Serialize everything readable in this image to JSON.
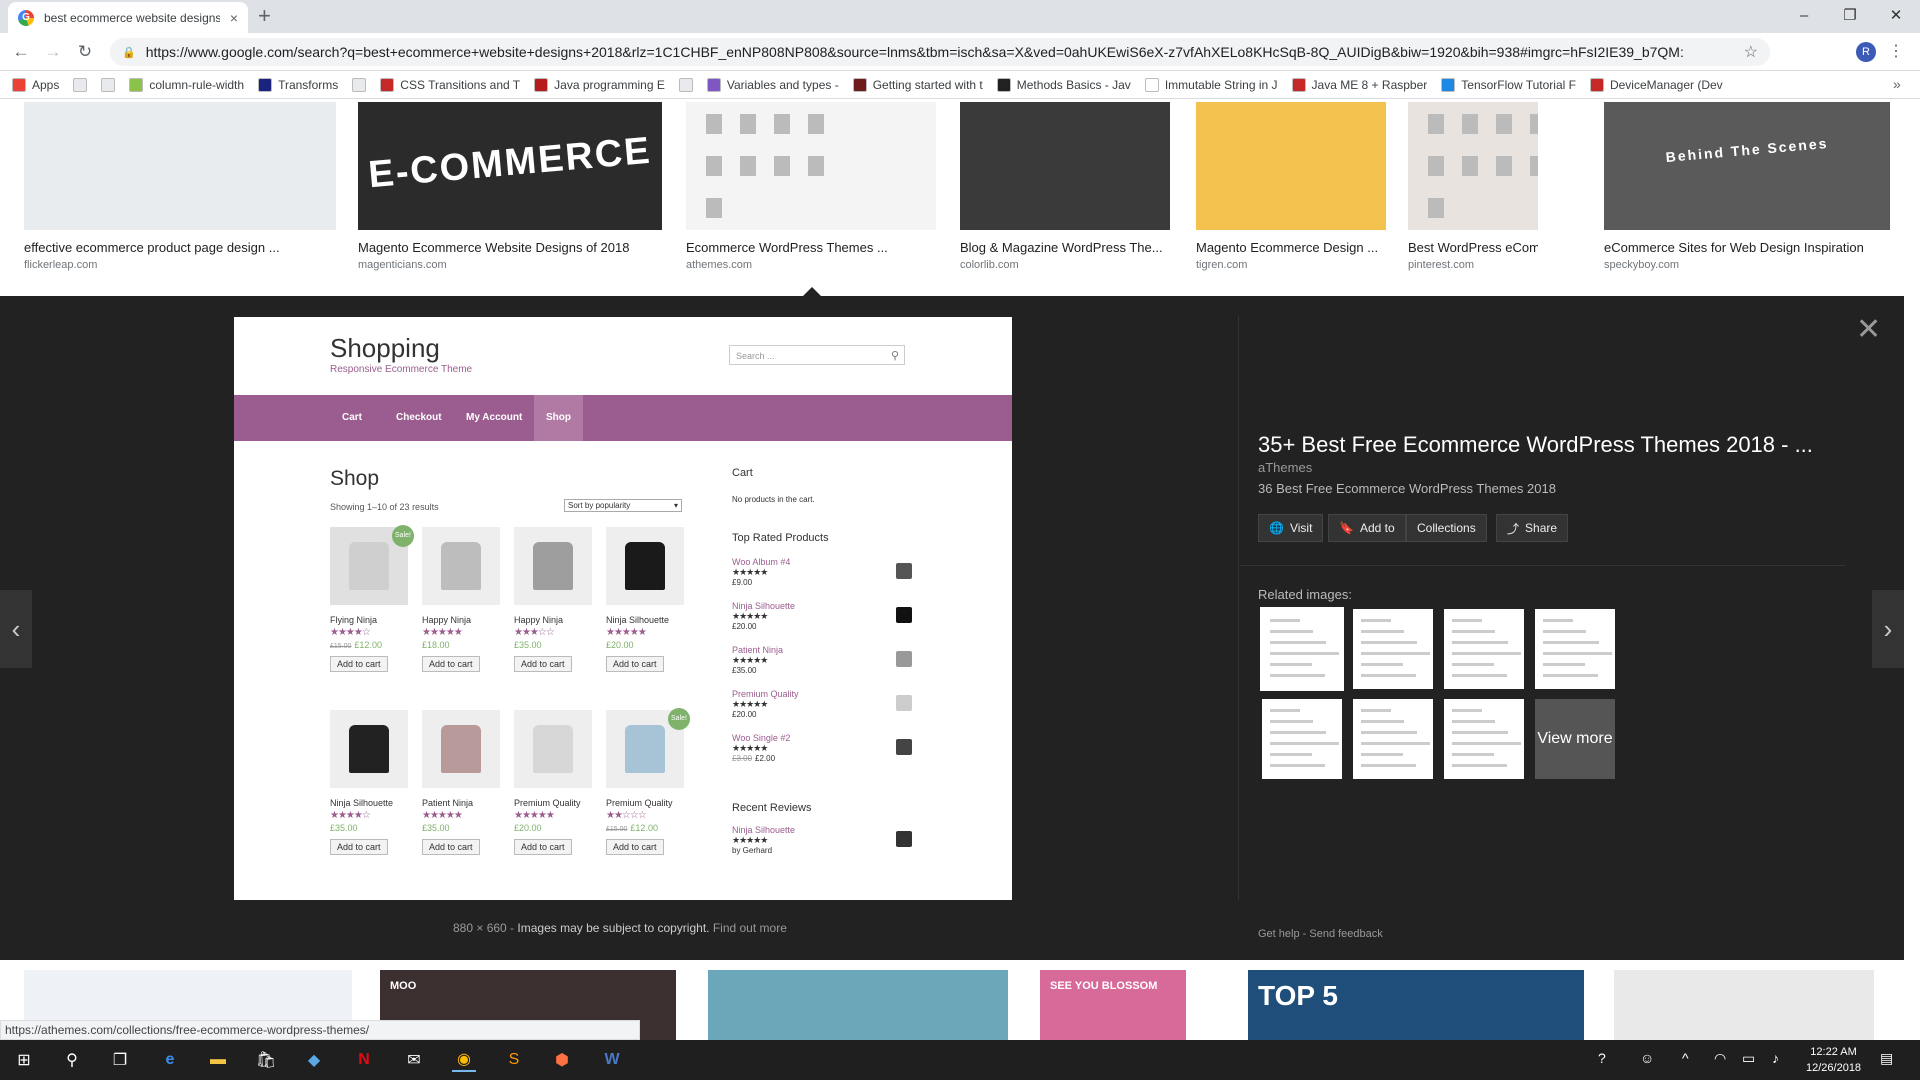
{
  "browser": {
    "tab_title": "best ecommerce website designs",
    "tab_close": "×",
    "new_tab": "+",
    "url": "https://www.google.com/search?q=best+ecommerce+website+designs+2018&rlz=1C1CHBF_enNP808NP808&source=lnms&tbm=isch&sa=X&ved=0ahUKEwiS6eX-z7vfAhXELo8KHcSqB-8Q_AUIDigB&biw=1920&bih=938#imgrc=hFsI2IE39_b7QM:",
    "profile_initial": "R",
    "window_controls": {
      "minimize": "–",
      "maximize": "❐",
      "close": "✕"
    }
  },
  "bookmarks": [
    {
      "label": "Apps",
      "color": "#ea4335"
    },
    {
      "label": "",
      "color": "#e8eaed"
    },
    {
      "label": "",
      "color": "#e8eaed"
    },
    {
      "label": "column-rule-width",
      "color": "#8bc34a"
    },
    {
      "label": "Transforms",
      "color": "#1a237e"
    },
    {
      "label": "",
      "color": "#e8eaed"
    },
    {
      "label": "CSS Transitions and T",
      "color": "#c62828"
    },
    {
      "label": "Java programming E",
      "color": "#b71c1c"
    },
    {
      "label": "",
      "color": "#e8eaed"
    },
    {
      "label": "Variables and types -",
      "color": "#7e57c2"
    },
    {
      "label": "Getting started with t",
      "color": "#6d1b1b"
    },
    {
      "label": "Methods Basics - Jav",
      "color": "#212121"
    },
    {
      "label": "Immutable String in J",
      "color": "#ffffff"
    },
    {
      "label": "Java ME 8 + Raspber",
      "color": "#c62828"
    },
    {
      "label": "TensorFlow Tutorial F",
      "color": "#1e88e5"
    },
    {
      "label": "DeviceManager (Dev",
      "color": "#c62828"
    }
  ],
  "top_results": [
    {
      "caption": "effective ecommerce product page design ...",
      "domain": "flickerleap.com",
      "bg": "#e9ecef"
    },
    {
      "caption": "Magento Ecommerce Website Designs of 2018",
      "domain": "magenticians.com",
      "bg": "#2b2b2b",
      "overlay": "E-COMMERCE"
    },
    {
      "caption": "Ecommerce WordPress Themes ...",
      "domain": "athemes.com",
      "bg": "#f4f4f4"
    },
    {
      "caption": "Blog & Magazine WordPress The...",
      "domain": "colorlib.com",
      "bg": "#3a3a3a"
    },
    {
      "caption": "Magento Ecommerce Design ...",
      "domain": "tigren.com",
      "bg": "#f2c14e"
    },
    {
      "caption": "Best WordPress eCommer...",
      "domain": "pinterest.com",
      "bg": "#e8e3de"
    },
    {
      "caption": "eCommerce Sites for Web Design Inspiration",
      "domain": "speckyboy.com",
      "bg": "#5a5a5a",
      "overlay": "Behind The Scenes"
    }
  ],
  "preview": {
    "site_title": "Shopping",
    "tagline": "Responsive Ecommerce Theme",
    "search_placeholder": "Search ...",
    "nav": [
      "Cart",
      "Checkout",
      "My Account",
      "Shop"
    ],
    "heading": "Shop",
    "result_count": "Showing 1–10 of 23 results",
    "sort": "Sort by popularity",
    "products": [
      {
        "name": "Flying Ninja",
        "stars": "★★★★☆",
        "old_price": "£15.00",
        "price": "£12.00",
        "sale": true,
        "color": "#e0e0e0",
        "tee": "#cfcfcf"
      },
      {
        "name": "Happy Ninja",
        "stars": "★★★★★",
        "old_price": "",
        "price": "£18.00",
        "sale": false,
        "color": "#eeeeee",
        "tee": "#bdbdbd"
      },
      {
        "name": "Happy Ninja",
        "stars": "★★★☆☆",
        "old_price": "",
        "price": "£35.00",
        "sale": false,
        "color": "#eeeeee",
        "tee": "#9e9e9e"
      },
      {
        "name": "Ninja Silhouette",
        "stars": "★★★★★",
        "old_price": "",
        "price": "£20.00",
        "sale": false,
        "color": "#eeeeee",
        "tee": "#1a1a1a"
      },
      {
        "name": "Ninja Silhouette",
        "stars": "★★★★☆",
        "old_price": "",
        "price": "£35.00",
        "sale": false,
        "color": "#eeeeee",
        "tee": "#222222"
      },
      {
        "name": "Patient Ninja",
        "stars": "★★★★★",
        "old_price": "",
        "price": "£35.00",
        "sale": false,
        "color": "#eeeeee",
        "tee": "#b89a9a"
      },
      {
        "name": "Premium Quality",
        "stars": "★★★★★",
        "old_price": "",
        "price": "£20.00",
        "sale": false,
        "color": "#eeeeee",
        "tee": "#d7d7d7"
      },
      {
        "name": "Premium Quality",
        "stars": "★★☆☆☆",
        "old_price": "£15.00",
        "price": "£12.00",
        "sale": true,
        "color": "#eeeeee",
        "tee": "#a7c4d6"
      }
    ],
    "add_to_cart": "Add to cart",
    "sale_badge": "Sale!",
    "cart_heading": "Cart",
    "cart_empty": "No products in the cart.",
    "top_rated_heading": "Top Rated Products",
    "top_rated": [
      {
        "name": "Woo Album #4",
        "stars": "★★★★★",
        "old_price": "",
        "price": "£9.00"
      },
      {
        "name": "Ninja Silhouette",
        "stars": "★★★★★",
        "old_price": "",
        "price": "£20.00"
      },
      {
        "name": "Patient Ninja",
        "stars": "★★★★★",
        "old_price": "",
        "price": "£35.00"
      },
      {
        "name": "Premium Quality",
        "stars": "★★★★★",
        "old_price": "",
        "price": "£20.00"
      },
      {
        "name": "Woo Single #2",
        "stars": "★★★★★",
        "old_price": "£3.00",
        "price": "£2.00"
      }
    ],
    "recent_reviews_heading": "Recent Reviews",
    "review": {
      "name": "Ninja Silhouette",
      "stars": "★★★★★",
      "by": "by Gerhard"
    }
  },
  "info": {
    "title": "35+ Best Free Ecommerce WordPress Themes 2018 - ...",
    "site": "aThemes",
    "description": "36 Best Free Ecommerce WordPress Themes 2018",
    "buttons": {
      "visit": "Visit",
      "add_to": "Add to",
      "collections": "Collections",
      "share": "Share"
    },
    "related_label": "Related images:",
    "view_more": "View more",
    "get_help": "Get help",
    "send_feedback": "Send feedback"
  },
  "meta": {
    "dimensions": "880 × 660",
    "sep": " - ",
    "copyright": "Images may be subject to copyright.",
    "find_out": "Find out more"
  },
  "bottom_results": [
    {
      "bg": "#eef2f7"
    },
    {
      "bg": "#3b2f2f",
      "label": "MOO"
    },
    {
      "bg": "#6aa7b9"
    },
    {
      "bg": "#d86a9a",
      "label": "SEE YOU BLOSSOM"
    },
    {
      "bg": "#1e4e79",
      "label": "TOP 5"
    },
    {
      "bg": "#e9e9e9"
    }
  ],
  "status_url": "https://athemes.com/collections/free-ecommerce-wordpress-themes/",
  "taskbar": {
    "time": "12:22 AM",
    "date": "12/26/2018"
  }
}
